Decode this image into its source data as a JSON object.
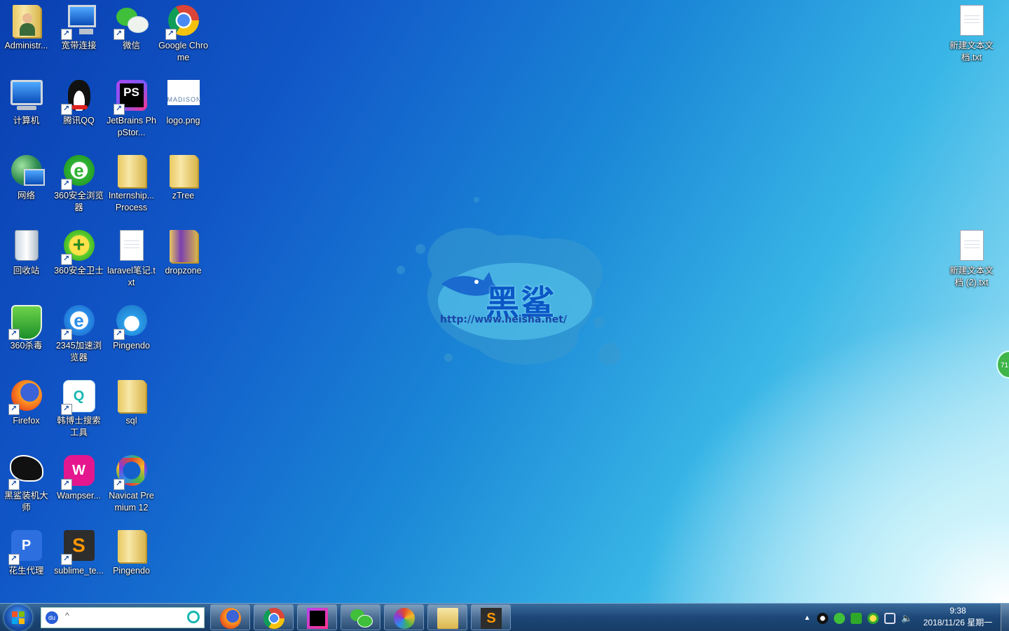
{
  "desktop_icons": [
    {
      "label": "Administr...",
      "icon": "user-folder-icon"
    },
    {
      "label": "宽带连接",
      "icon": "broadband-connection-icon"
    },
    {
      "label": "微信",
      "icon": "wechat-icon"
    },
    {
      "label": "Google Chrome",
      "icon": "chrome-icon"
    },
    {
      "label": "计算机",
      "icon": "computer-icon"
    },
    {
      "label": "腾讯QQ",
      "icon": "qq-icon"
    },
    {
      "label": "JetBrains PhpStor...",
      "icon": "phpstorm-icon"
    },
    {
      "label": "logo.png",
      "icon": "image-file-icon"
    },
    {
      "label": "网络",
      "icon": "network-icon"
    },
    {
      "label": "360安全浏览器",
      "icon": "360-browser-icon"
    },
    {
      "label": "Internship... Process",
      "icon": "folder-icon"
    },
    {
      "label": "zTree",
      "icon": "folder-icon"
    },
    {
      "label": "回收站",
      "icon": "recycle-bin-icon"
    },
    {
      "label": "360安全卫士",
      "icon": "360-security-icon"
    },
    {
      "label": "laravel笔记.txt",
      "icon": "text-file-icon"
    },
    {
      "label": "dropzone",
      "icon": "folder-icon"
    },
    {
      "label": "360杀毒",
      "icon": "360-antivirus-icon"
    },
    {
      "label": "2345加速浏览器",
      "icon": "2345-browser-icon"
    },
    {
      "label": "Pingendo",
      "icon": "pingendo-icon"
    },
    {
      "label": "Firefox",
      "icon": "firefox-icon"
    },
    {
      "label": "韩博士搜索工具",
      "icon": "search-tool-icon"
    },
    {
      "label": "sql",
      "icon": "folder-icon"
    },
    {
      "label": "黑鲨装机大师",
      "icon": "heisha-shark-icon"
    },
    {
      "label": "Wampser...",
      "icon": "wampserver-icon"
    },
    {
      "label": "Navicat Premium 12",
      "icon": "navicat-icon"
    },
    {
      "label": "花生代理",
      "icon": "peanut-proxy-icon"
    },
    {
      "label": "sublime_te...",
      "icon": "sublime-text-icon"
    },
    {
      "label": "Pingendo",
      "icon": "folder-icon"
    },
    {
      "label": "新建文本文档.txt",
      "icon": "text-file-icon"
    },
    {
      "label": "新建文本文档 (2).txt",
      "icon": "text-file-icon"
    }
  ],
  "wallpaper": {
    "brand": "黑鲨",
    "url": "http://www.heisha.net/"
  },
  "side_widget": {
    "value": "71"
  },
  "taskbar": {
    "start_icon": "windows-logo-icon",
    "search_placeholder": "",
    "pinned": [
      "firefox",
      "chrome",
      "phpstorm",
      "wechat",
      "navicat",
      "file-explorer",
      "sublime-text"
    ],
    "clock_time": "9:38",
    "clock_date": "2018/11/26 星期一"
  },
  "colors": {
    "taskbar": "#1c4777",
    "desktop_dark": "#0a3fb0",
    "desktop_light": "#8ad8f2"
  }
}
